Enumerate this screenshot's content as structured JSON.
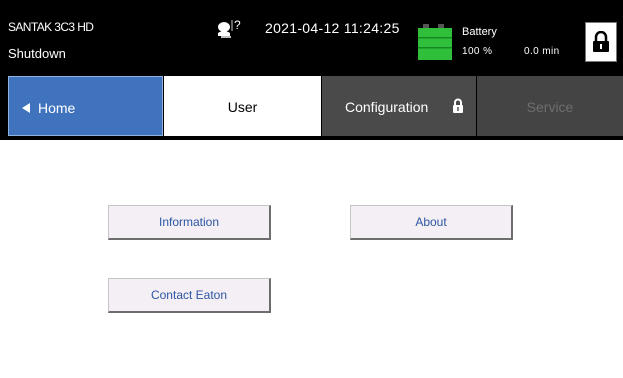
{
  "status": {
    "model": "SANTAK 3C3 HD",
    "state": "Shutdown",
    "datetime": "2021-04-12 11:24:25",
    "help_icon": "question-mark-help-icon",
    "battery": {
      "title": "Battery",
      "charge": "100 %",
      "runtime": "0.0 min",
      "icon": "battery-icon",
      "color": "#2fbf3a"
    },
    "lock_icon": "padlock-icon"
  },
  "tabs": [
    {
      "label": "Home",
      "icon": "left-arrow-icon",
      "color": "#3f73bd",
      "active": false
    },
    {
      "label": "User",
      "color": "#ffffff",
      "active": true
    },
    {
      "label": "Configuration",
      "icon": "padlock-icon",
      "color": "#4a4a4a",
      "active": false
    },
    {
      "label": "Service",
      "color": "#444444",
      "disabled": true
    }
  ],
  "buttons": {
    "information": "Information",
    "about": "About",
    "contact": "Contact Eaton"
  },
  "colors": {
    "accent_blue": "#3f73bd",
    "button_text": "#2b55a3",
    "button_bg": "#f4eff4"
  }
}
